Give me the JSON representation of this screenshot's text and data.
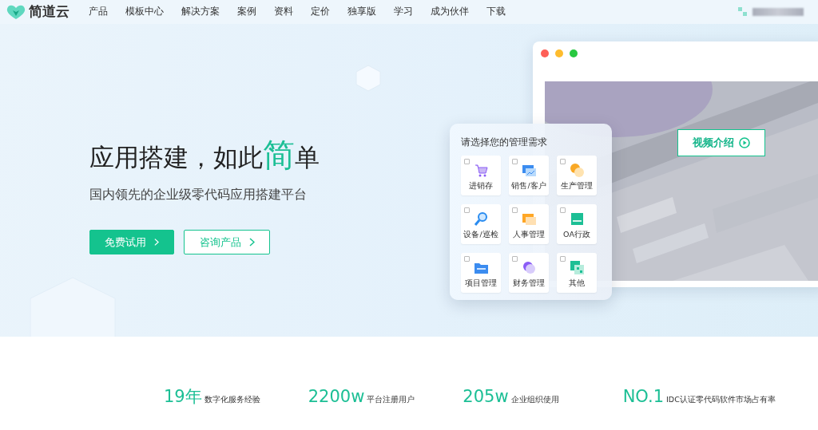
{
  "brand": "简道云",
  "nav": [
    {
      "label": "产品"
    },
    {
      "label": "模板中心"
    },
    {
      "label": "解决方案"
    },
    {
      "label": "案例"
    },
    {
      "label": "资料"
    },
    {
      "label": "定价"
    },
    {
      "label": "独享版"
    },
    {
      "label": "学习"
    },
    {
      "label": "成为伙伴"
    },
    {
      "label": "下载"
    }
  ],
  "hero": {
    "title_parts": [
      {
        "text": "应用搭建，如此",
        "highlight": false
      },
      {
        "text": "简",
        "highlight": true
      },
      {
        "text": "单",
        "highlight": false
      }
    ],
    "subtitle": "国内领先的企业级零代码应用搭建平台",
    "buttons": [
      {
        "label": "免费试用",
        "kind": "primary"
      },
      {
        "label": "咨询产品",
        "kind": "outline"
      }
    ]
  },
  "needs_panel": {
    "title": "请选择您的管理需求",
    "options": [
      {
        "label": "进销存",
        "checked": false
      },
      {
        "label": "销售/客户",
        "checked": false
      },
      {
        "label": "生产管理",
        "checked": false
      },
      {
        "label": "设备/巡检",
        "checked": false
      },
      {
        "label": "人事管理",
        "checked": false
      },
      {
        "label": "OA行政",
        "checked": false
      },
      {
        "label": "项目管理",
        "checked": false
      },
      {
        "label": "财务管理",
        "checked": false
      },
      {
        "label": "其他",
        "checked": false
      }
    ]
  },
  "video": {
    "button": "视频介绍"
  },
  "stats": [
    {
      "value": "19年",
      "label": "数字化服务经验"
    },
    {
      "value": "2200w",
      "label": "平台注册用户"
    },
    {
      "value": "205w",
      "label": "企业组织使用"
    },
    {
      "value": "NO.1",
      "label": "IDC认证零代码软件市场占有率"
    }
  ]
}
